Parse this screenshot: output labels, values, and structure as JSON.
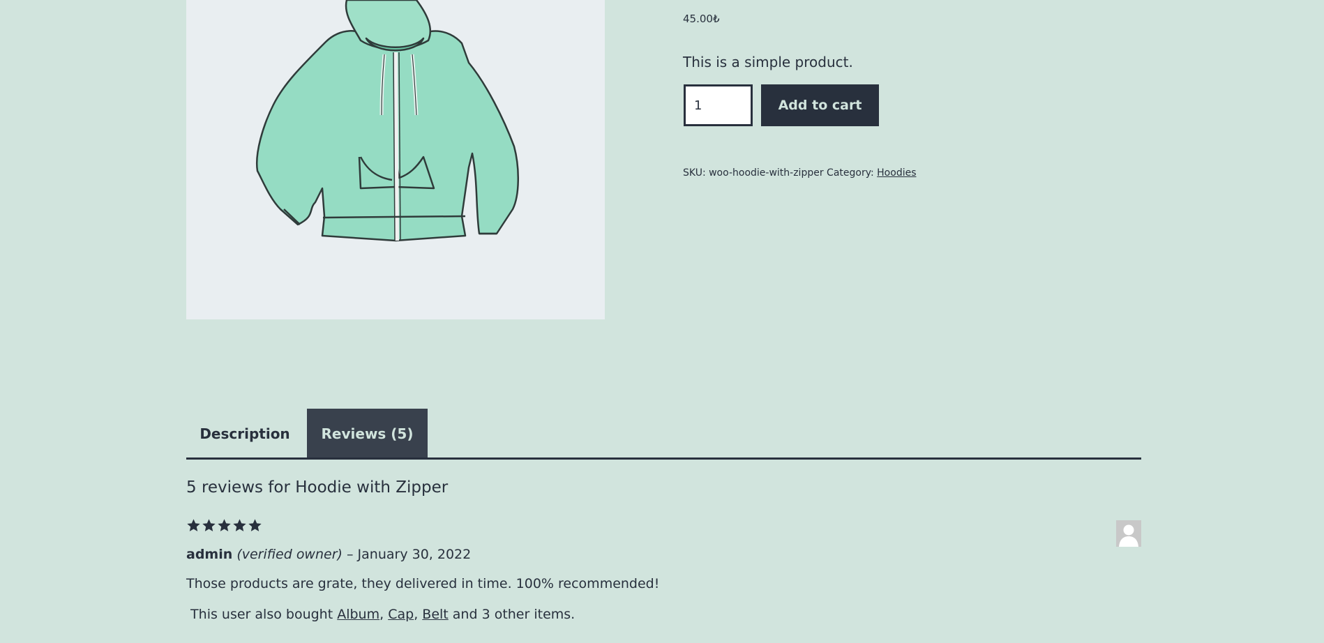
{
  "product": {
    "price": "45.00₺",
    "short_description": "This is a simple product.",
    "quantity": "1",
    "add_to_cart_label": "Add to cart",
    "sku_label": "SKU:",
    "sku": "woo-hoodie-with-zipper",
    "category_label": "Category:",
    "category": "Hoodies",
    "image_icon": "hoodie-image"
  },
  "tabs": [
    {
      "label": "Description",
      "active": false
    },
    {
      "label": "Reviews (5)",
      "active": true
    }
  ],
  "reviews": {
    "title": "5 reviews for Hoodie with Zipper",
    "items": [
      {
        "rating": 5,
        "author": "admin",
        "verified": "(verified owner)",
        "separator": "–",
        "date": "January 30, 2022",
        "text": "Those products are grate, they delivered in time. 100% recommended!",
        "also_bought_prefix": "This user also bought",
        "also_bought_items": [
          "Album",
          "Cap",
          "Belt"
        ],
        "also_bought_suffix": "and 3 other items."
      }
    ]
  },
  "colors": {
    "background": "#d1e4dd",
    "text": "#28303d",
    "image_bg": "#e9eef1",
    "active_tab": "#39414d",
    "hoodie": "#8fd8bf"
  }
}
